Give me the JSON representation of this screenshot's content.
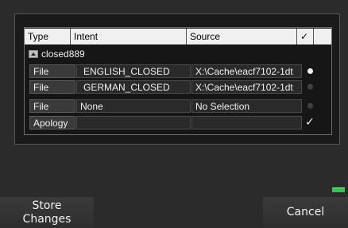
{
  "table": {
    "columns": [
      "Type",
      "Intent",
      "Source",
      "✓",
      ""
    ],
    "group": {
      "label": "closed889"
    },
    "rows": [
      {
        "type": "File",
        "intent": "ENGLISH_CLOSED",
        "source": "X:\\Cache\\eacf7102-1dt",
        "status": "dot-on"
      },
      {
        "type": "File",
        "intent": "GERMAN_CLOSED",
        "source": "X:\\Cache\\eacf7102-1dt",
        "status": "dot-off"
      },
      {
        "type": "File",
        "intent": "None",
        "source": "No Selection",
        "status": "dot-off"
      },
      {
        "type": "Apology",
        "intent": "",
        "source": "",
        "status": "check"
      }
    ]
  },
  "buttons": {
    "store_line1": "Store",
    "store_line2": "Changes",
    "cancel": "Cancel"
  },
  "colors": {
    "indicator": "#2fc55a",
    "header_bg": "#f0f0f0"
  }
}
